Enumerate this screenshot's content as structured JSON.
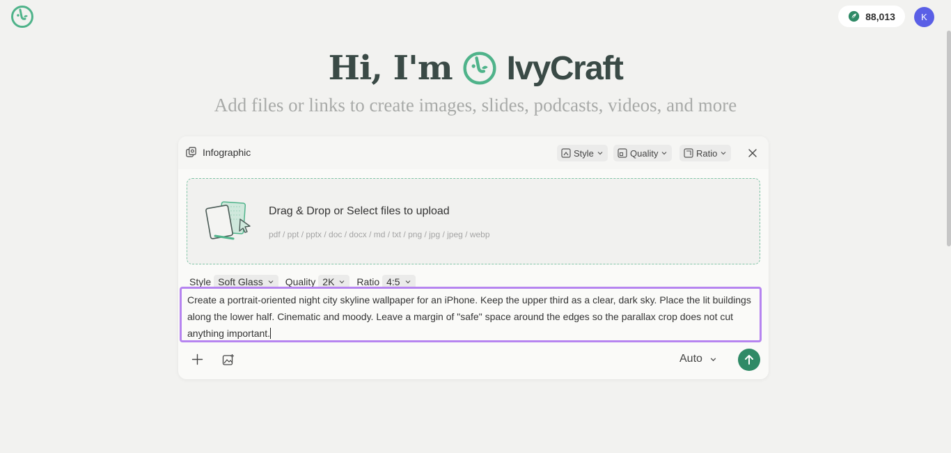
{
  "header": {
    "logo_icon": "ivycraft-logo-icon",
    "credits_icon": "leaf-icon",
    "credits": "88,013",
    "avatar_initial": "K"
  },
  "hero": {
    "greeting": "Hi, I'm",
    "brand": "IvyCraft",
    "subtitle": "Add files or links to create images, slides, podcasts, videos, and more"
  },
  "card": {
    "mode_label": "Infographic",
    "header_buttons": [
      {
        "label": "Style",
        "icon": "style-icon"
      },
      {
        "label": "Quality",
        "icon": "quality-icon"
      },
      {
        "label": "Ratio",
        "icon": "ratio-icon"
      }
    ],
    "upload": {
      "title": "Drag & Drop or Select files to upload",
      "formats": "pdf / ppt / pptx / doc / docx / md / txt / png / jpg / jpeg / webp"
    },
    "settings": {
      "style_label": "Style",
      "style_value": "Soft Glass",
      "quality_label": "Quality",
      "quality_value": "2K",
      "ratio_label": "Ratio",
      "ratio_value": "4:5"
    },
    "prompt": "Create a portrait-oriented night city skyline wallpaper for an iPhone. Keep the upper third as a clear, dark sky. Place the lit buildings along the lower half. Cinematic and moody. Leave a margin of \"safe\" space around the edges so the parallax crop does not cut anything important.",
    "model_select": "Auto"
  },
  "colors": {
    "accent": "#2f8a66",
    "brand_green": "#4fb38a",
    "focus_border": "#b684f0",
    "avatar": "#5a5fe6"
  }
}
